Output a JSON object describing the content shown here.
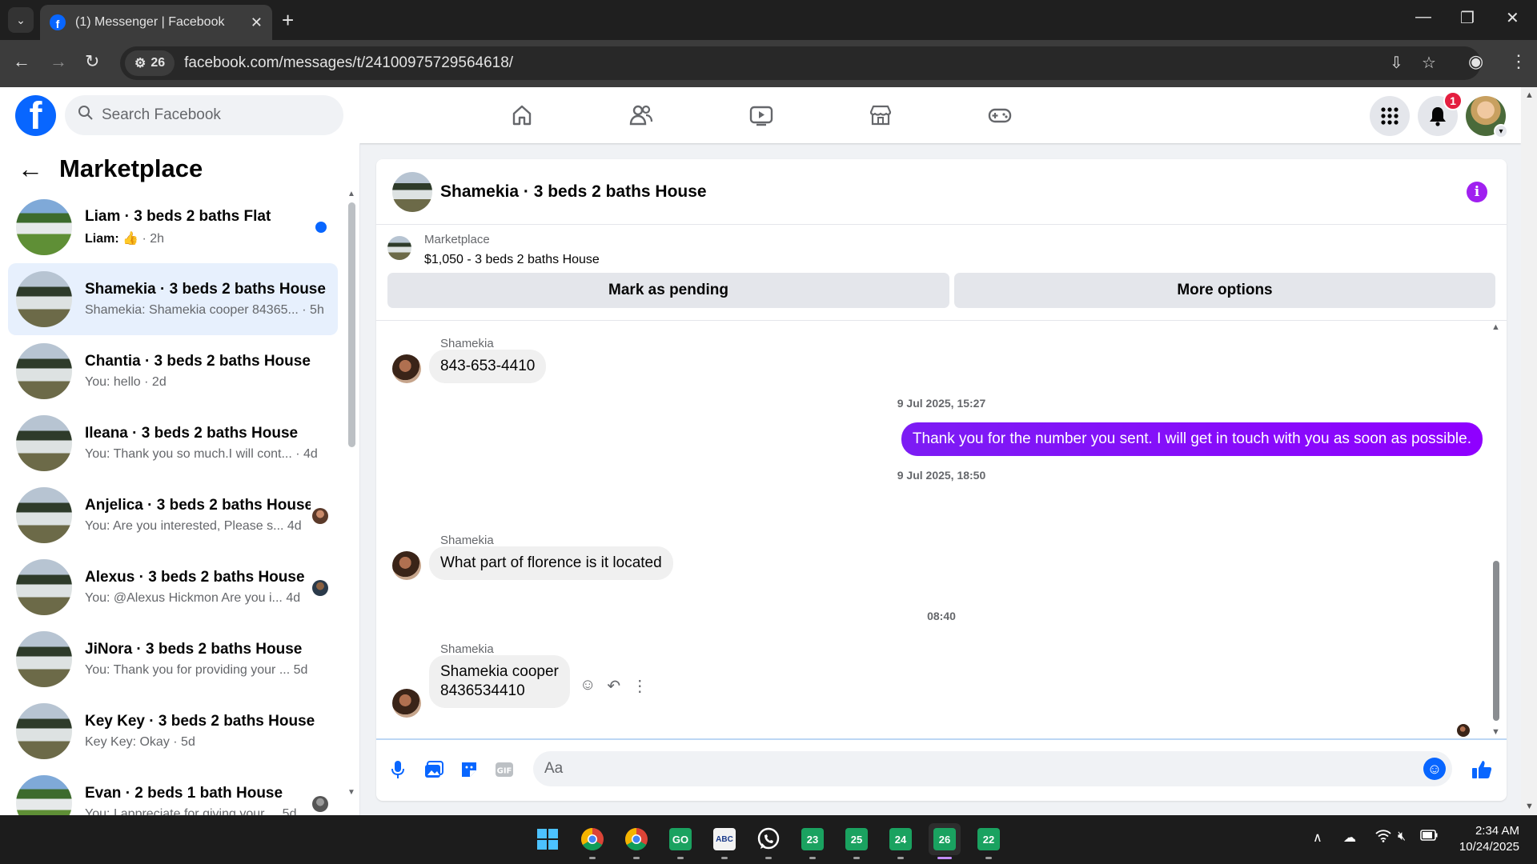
{
  "browser": {
    "tab_title": "(1) Messenger | Facebook",
    "tab_close": "✕",
    "new_tab": "+",
    "site_info_count": "26",
    "url": "facebook.com/messages/t/24100975729564618/"
  },
  "fb": {
    "search_placeholder": "Search Facebook",
    "notification_count": "1"
  },
  "left": {
    "title": "Marketplace",
    "conversations": [
      {
        "name": "Liam · 3 beds 2 baths Flat",
        "preview_sender": "Liam:",
        "preview": "👍 · 2h",
        "unread": true
      },
      {
        "name": "Shamekia · 3 beds 2 baths House",
        "preview": "Shamekia: Shamekia cooper 84365... · 5h",
        "active": true
      },
      {
        "name": "Chantia · 3 beds 2 baths House",
        "preview": "You: hello · 2d"
      },
      {
        "name": "Ileana · 3 beds 2 baths House",
        "preview": "You: Thank you so much.I will cont... · 4d"
      },
      {
        "name": "Anjelica · 3 beds 2 baths House",
        "preview": "You: Are you interested, Please s...  4d"
      },
      {
        "name": "Alexus · 3 beds 2 baths House",
        "preview": "You: @Alexus Hickmon Are you i...  4d"
      },
      {
        "name": "JiNora · 3 beds 2 baths House",
        "preview": "You: Thank you for providing your ...  5d"
      },
      {
        "name": "Key Key · 3 beds 2 baths House",
        "preview": "Key Key: Okay · 5d"
      },
      {
        "name": "Evan · 2 beds 1 bath House",
        "preview": "You: I appreciate for giving your ... 5d"
      }
    ]
  },
  "chat": {
    "title": "Shamekia · 3 beds 2 baths House",
    "listing_label": "Marketplace",
    "listing_price": "$1,050 - 3 beds 2 baths House",
    "btn_pending": "Mark as pending",
    "btn_more": "More options",
    "messages": [
      {
        "sender": "Shamekia",
        "text": "843-653-4410"
      },
      {
        "timestamp": "9 Jul 2025, 15:27"
      },
      {
        "out": "Thank you for the number you sent. I will get in touch with you as soon as possible."
      },
      {
        "timestamp": "9 Jul 2025, 18:50"
      },
      {
        "sender": "Shamekia",
        "text": "What part of florence is it located"
      },
      {
        "timestamp": "08:40"
      },
      {
        "sender": "Shamekia",
        "text_line1": "Shamekia cooper",
        "text_line2": "8436534410"
      }
    ],
    "composer_placeholder": "Aa"
  },
  "taskbar": {
    "apps": [
      "23",
      "25",
      "24",
      "26",
      "22"
    ],
    "time": "2:34 AM",
    "date": "10/24/2025"
  }
}
